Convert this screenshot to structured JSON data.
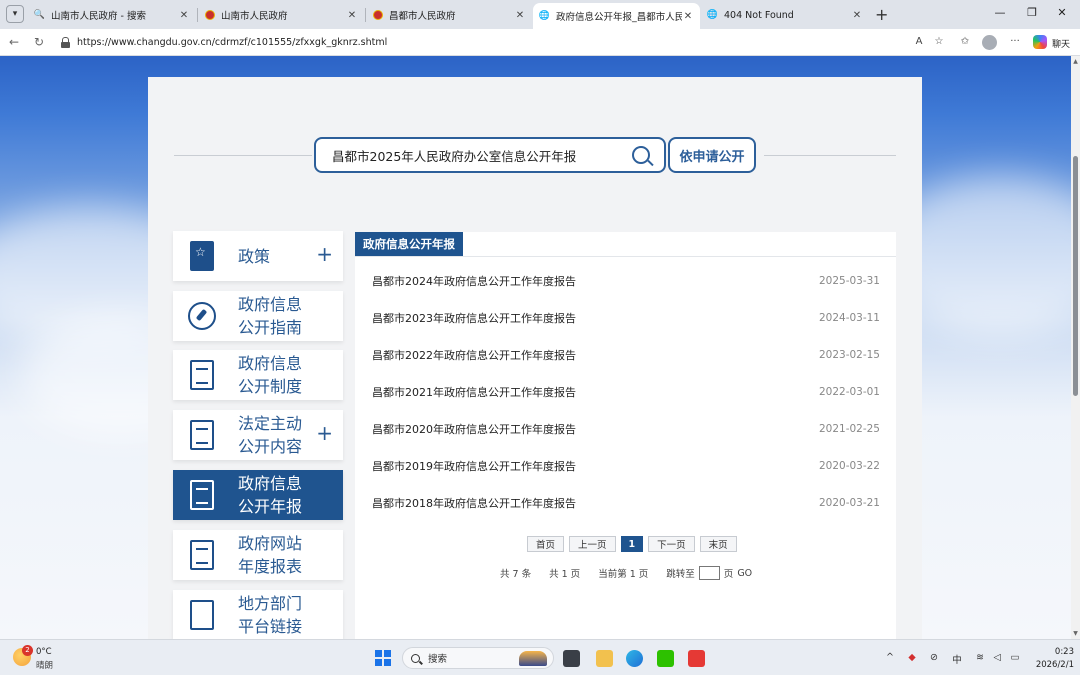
{
  "browser": {
    "tabs": [
      {
        "title": "山南市人民政府 - 搜索",
        "icon": "search-favicon"
      },
      {
        "title": "山南市人民政府",
        "icon": "emblem-favicon"
      },
      {
        "title": "昌都市人民政府",
        "icon": "emblem-favicon"
      },
      {
        "title": "政府信息公开年报_昌都市人民政府",
        "icon": "globe-favicon",
        "active": true
      },
      {
        "title": "404 Not Found",
        "icon": "globe-favicon"
      }
    ],
    "url": "https://www.changdu.gov.cn/cdrmzf/c101555/zfxxgk_gknrz.shtml",
    "chat_label": "聊天"
  },
  "page": {
    "search_value": "昌都市2025年人民政府办公室信息公开年报",
    "apply_button": "依申请公开",
    "sidebar": [
      {
        "label": "政策",
        "icon": "policy-doc-icon",
        "expandable": true
      },
      {
        "label": "政府信息公开指南",
        "icon": "compass-icon"
      },
      {
        "label": "政府信息公开制度",
        "icon": "list-doc-icon"
      },
      {
        "label": "法定主动公开内容",
        "icon": "clipboard-pen-icon",
        "expandable": true
      },
      {
        "label": "政府信息公开年报",
        "icon": "folder-doc-icon",
        "active": true
      },
      {
        "label": "政府网站年度报表",
        "icon": "list-doc-icon"
      },
      {
        "label": "地方部门平台链接",
        "icon": "network-icon"
      }
    ],
    "section_title": "政府信息公开年报",
    "reports": [
      {
        "title": "昌都市2024年政府信息公开工作年度报告",
        "date": "2025-03-31"
      },
      {
        "title": "昌都市2023年政府信息公开工作年度报告",
        "date": "2024-03-11"
      },
      {
        "title": "昌都市2022年政府信息公开工作年度报告",
        "date": "2023-02-15"
      },
      {
        "title": "昌都市2021年政府信息公开工作年度报告",
        "date": "2022-03-01"
      },
      {
        "title": "昌都市2020年政府信息公开工作年度报告",
        "date": "2021-02-25"
      },
      {
        "title": "昌都市2019年政府信息公开工作年度报告",
        "date": "2020-03-22"
      },
      {
        "title": "昌都市2018年政府信息公开工作年度报告",
        "date": "2020-03-21"
      }
    ],
    "pagination": {
      "first": "首页",
      "prev": "上一页",
      "current": "1",
      "next": "下一页",
      "last": "末页",
      "total_items": "共 7 条",
      "total_pages": "共 1 页",
      "current_page": "当前第 1 页",
      "jump_label": "跳转至",
      "page_unit": "页",
      "go": "GO"
    }
  },
  "taskbar": {
    "weather_temp": "0°C",
    "weather_desc": "晴朗",
    "weather_badge": "2",
    "search_placeholder": "搜索",
    "ime": "中",
    "time": "0:23",
    "date": "2026/2/1"
  },
  "colors": {
    "brand_blue": "#1f548f",
    "search_border": "#2d5f9a"
  }
}
